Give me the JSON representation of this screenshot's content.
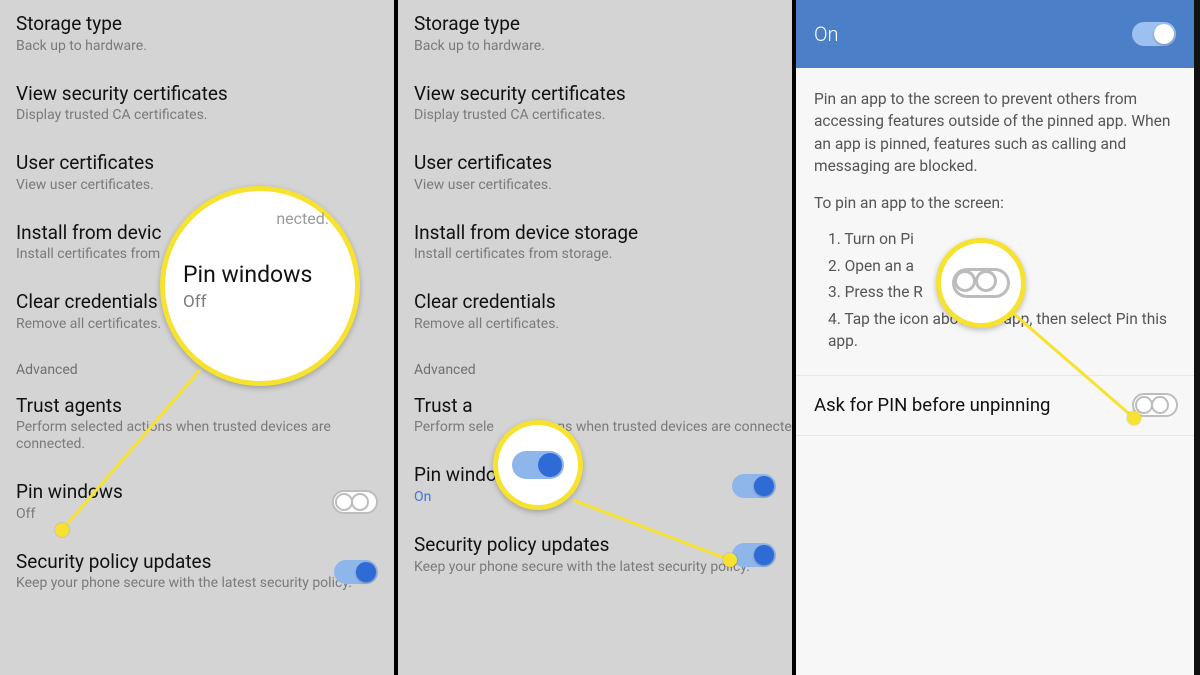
{
  "paneA": {
    "storage": {
      "title": "Storage type",
      "sub": "Back up to hardware."
    },
    "certs": {
      "title": "View security certificates",
      "sub": "Display trusted CA certificates."
    },
    "usercerts": {
      "title": "User certificates",
      "sub": "View user certificates."
    },
    "install": {
      "title": "Install from devic",
      "sub": "Install certificates from"
    },
    "clear": {
      "title": "Clear credentials",
      "sub": "Remove all certificates."
    },
    "advanced": "Advanced",
    "trust": {
      "title": "Trust agents",
      "sub": "Perform selected actions when trusted devices are connected."
    },
    "pin": {
      "title": "Pin windows",
      "sub": "Off"
    },
    "policy": {
      "title": "Security policy updates",
      "sub": "Keep your phone secure with the latest security policy."
    },
    "callout": {
      "extra": "nected.",
      "title": "Pin windows",
      "sub": "Off"
    }
  },
  "paneB": {
    "storage": {
      "title": "Storage type",
      "sub": "Back up to hardware."
    },
    "certs": {
      "title": "View security certificates",
      "sub": "Display trusted CA certificates."
    },
    "usercerts": {
      "title": "User certificates",
      "sub": "View user certificates."
    },
    "install": {
      "title": "Install from device storage",
      "sub": "Install certificates from storage."
    },
    "clear": {
      "title": "Clear credentials",
      "sub": "Remove all certificates."
    },
    "advanced": "Advanced",
    "trust": {
      "title": "Trust a",
      "sub": "Perform sele                ons when trusted devices are connected."
    },
    "pin": {
      "title": "Pin windows",
      "sub": "On"
    },
    "policy": {
      "title": "Security policy updates",
      "sub": "Keep your phone secure with the latest security policy."
    }
  },
  "paneC": {
    "bar": {
      "title": "On"
    },
    "explain1": "Pin an app to the screen to prevent others from accessing features outside of the pinned app. When an app is pinned, features such as calling and messaging are blocked.",
    "explain2": "To pin an app to the screen:",
    "steps": [
      "1. Turn on Pi",
      "2. Open an a",
      "3. Press the R                 tton.",
      "4. Tap the icon above the app, then select Pin this app."
    ],
    "ask": {
      "title": "Ask for PIN before unpinning"
    }
  }
}
